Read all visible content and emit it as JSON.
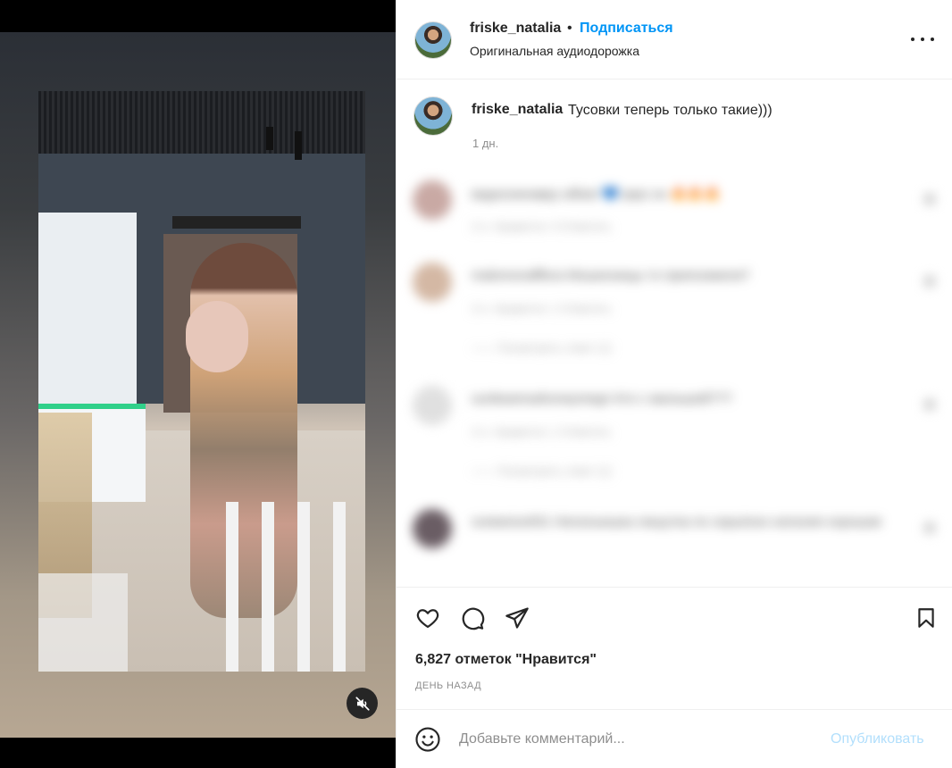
{
  "post": {
    "username": "friske_natalia",
    "follow_label": "Подписаться",
    "separator": "•",
    "audio_label": "Оригинальная аудиодорожка"
  },
  "caption": {
    "username": "friske_natalia",
    "text": "Тусовки теперь только такие)))",
    "time": "1 дн."
  },
  "comments": [
    {
      "text": "ваднонинавру aifiast 💙 ркрс кн 🔥🔥🔥",
      "meta": "2 н.    Нравится: 3    Ответить",
      "replies": ""
    },
    {
      "text": "malomonafflora Мошенницы то припсюжели?",
      "meta": "2 н.    Нравится: 1    Ответить",
      "replies": "——    Посмотреть ответ (1)"
    },
    {
      "text": "sunbeamsahoneymegn Кто с малышей???",
      "meta": "2 н.    Нравится: 1    Ответить",
      "replies": "——    Посмотреть ответ (1)"
    },
    {
      "text": "svetanice001 Натальюшка лишутка по серьёзно наталия хорошая",
      "meta": "",
      "replies": ""
    }
  ],
  "actions": {
    "likes": "6,827 отметок \"Нравится\"",
    "date": "ДЕНЬ НАЗАД"
  },
  "comment_box": {
    "placeholder": "Добавьте комментарий...",
    "publish_label": "Опубликовать"
  },
  "colors": {
    "accent": "#0095f6",
    "publish_disabled": "#b2dffc",
    "text": "#262626",
    "muted": "#8e8e8e"
  },
  "icons": [
    "mute-icon",
    "more-icon",
    "heart-icon",
    "comment-icon",
    "share-icon",
    "bookmark-icon",
    "emoji-icon"
  ]
}
